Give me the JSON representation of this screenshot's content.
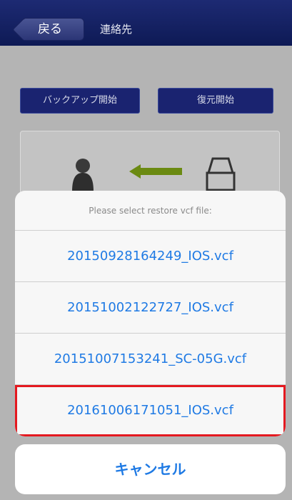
{
  "navbar": {
    "back_label": "戻る",
    "title": "連絡先"
  },
  "actions": {
    "backup_label": "バックアップ開始",
    "restore_label": "復元開始"
  },
  "icons": {
    "person": "person-icon",
    "arrow": "arrow-left-icon",
    "drive": "drive-icon"
  },
  "sheet": {
    "title": "Please select restore vcf file:",
    "files": [
      "20150928164249_IOS.vcf",
      "20151002122727_IOS.vcf",
      "20151007153241_SC-05G.vcf",
      "20161006171051_IOS.vcf"
    ],
    "highlighted_index": 3,
    "cancel_label": "キャンセル"
  },
  "colors": {
    "navbar": "#0e1a55",
    "link": "#1f7ae4",
    "highlight": "#e41920"
  }
}
